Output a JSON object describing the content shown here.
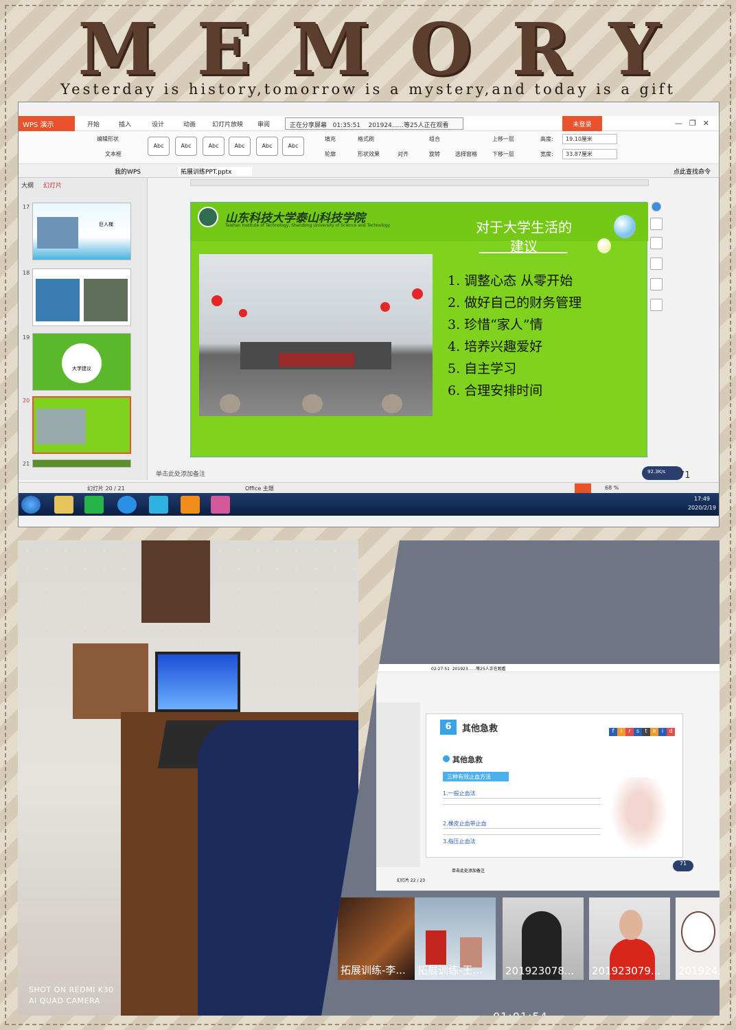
{
  "header": {
    "title": "MEMORY",
    "subtitle": "Yesterday is history,tomorrow is a mystery,and today is a gift"
  },
  "top_screen": {
    "app_label": "WPS 演示",
    "menu": [
      "开始",
      "插入",
      "设计",
      "动画",
      "幻灯片放映",
      "审阅"
    ],
    "share_status": "正在分享屏幕",
    "share_time": "01:35:51",
    "share_viewers": "201924......等25人正在观看",
    "login_label": "未登录",
    "ribbon": {
      "edit_shape": "编辑形状",
      "textbox": "文本框",
      "style_buttons": [
        "Abc",
        "Abc",
        "Abc",
        "Abc",
        "Abc",
        "Abc"
      ],
      "fill": "填充",
      "format_brush": "格式刷",
      "outline": "轮廓",
      "shape_effect": "形状效果",
      "align": "对齐",
      "combine": "组合",
      "rotate": "旋转",
      "selection_pane": "选择窗格",
      "move_up": "上移一层",
      "move_down": "下移一层",
      "height_label": "高度:",
      "height_value": "19.10厘米",
      "width_label": "宽度:",
      "width_value": "33.87厘米"
    },
    "tabs": {
      "mywps": "我的WPS",
      "file": "拓展训练PPT.pptx",
      "comment": "点此查找命令"
    },
    "left_pane": {
      "outline_tab": "大纲",
      "slides_tab": "幻灯片",
      "thumbs": [
        {
          "num": "17",
          "caption": "巨人梯"
        },
        {
          "num": "18",
          "caption": ""
        },
        {
          "num": "19",
          "caption": "大学建议"
        },
        {
          "num": "20",
          "caption": ""
        },
        {
          "num": "21",
          "caption": ""
        }
      ]
    },
    "slide": {
      "school_cn": "山东科技大学泰山科技学院",
      "school_en": "Taishan Institute of Technology, Shandong University of Science and Technology",
      "title_line1": "对于大学生活的",
      "title_line2": "建议",
      "items": [
        "1. 调整心态 从零开始",
        "2. 做好自己的财务管理",
        "3. 珍惜“家人”情",
        "4. 培养兴趣爱好",
        "5. 自主学习",
        "6. 合理安排时间"
      ]
    },
    "notes_placeholder": "单击此处添加备注",
    "status": {
      "slide_counter": "幻灯片 20 / 21",
      "theme": "Office 主题",
      "zoom": "68 %"
    },
    "speed": "92.3K/s",
    "battery": "71",
    "clock_time": "17:49",
    "clock_date": "2020/2/19"
  },
  "photo": {
    "camera_line1": "SHOT ON REDMI K30",
    "camera_line2": "AI QUAD CAMERA"
  },
  "bottom_screen": {
    "slide_number": "6",
    "slide_title": "其他急救",
    "brand_letters": [
      "f",
      "i",
      "r",
      "s",
      "t",
      "a",
      "i",
      "d"
    ],
    "section": "其他急救",
    "bar_label": "三种有效止血方法",
    "items": [
      "1.一般止血法",
      "2.橡皮止血带止血",
      "3.指压止血法"
    ],
    "share_time": "02:27:51",
    "share_viewers": "201923......等25人正在观看",
    "slide_counter": "幻灯片 22 / 23",
    "notes_placeholder": "单击此处添加备注",
    "battery": "71",
    "participants": [
      {
        "label": "拓展训练-李..."
      },
      {
        "label": "拓展训练-王..."
      },
      {
        "label": "201923078..."
      },
      {
        "label": "201923079..."
      },
      {
        "label": "201924..."
      }
    ],
    "timer": "01:01:54"
  },
  "colors": {
    "title_brown": "#5b3e2e",
    "slide_green": "#7fd31d",
    "wps_orange": "#e8532c",
    "taskbar_blue": "#1f3b6a"
  }
}
